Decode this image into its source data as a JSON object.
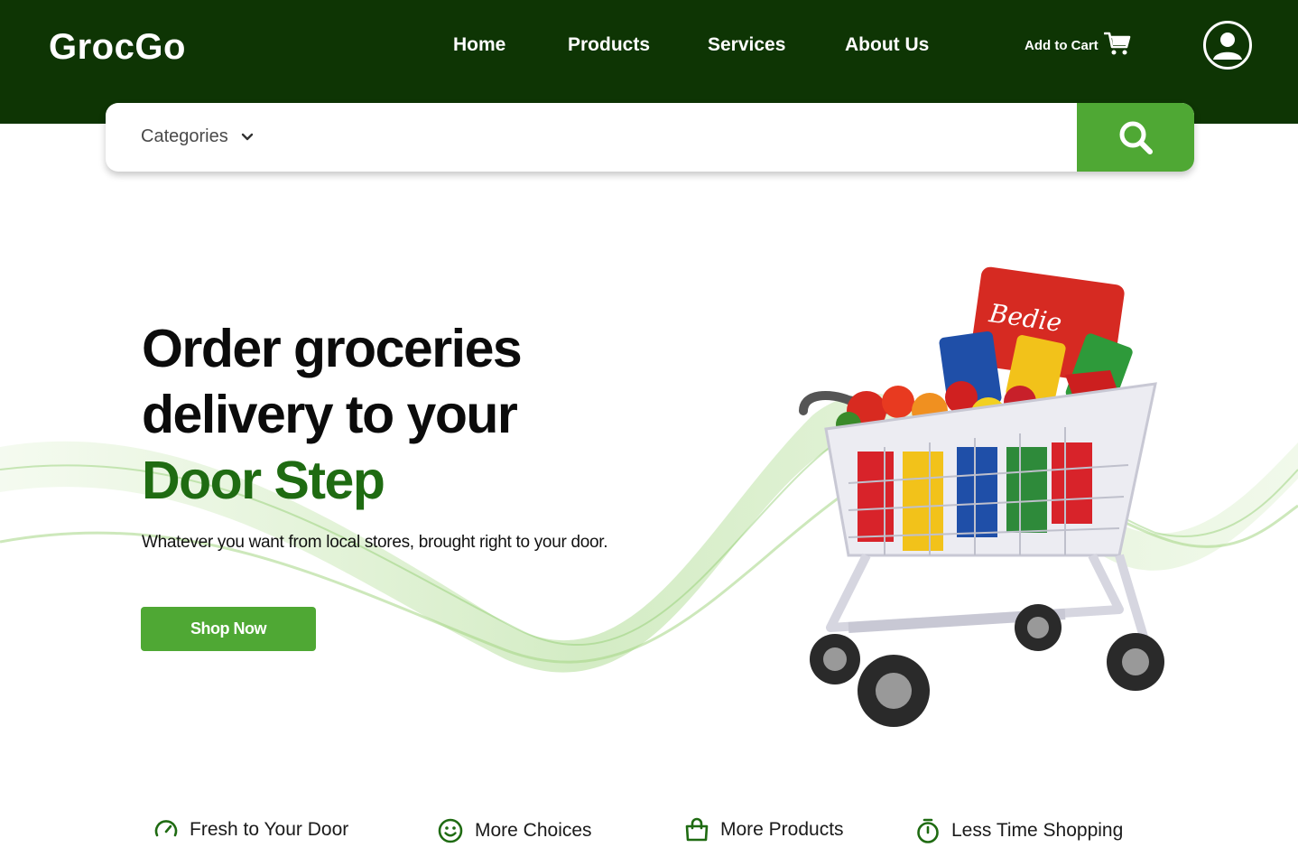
{
  "header": {
    "logo": "GrocGo",
    "nav": [
      {
        "label": "Home"
      },
      {
        "label": "Products"
      },
      {
        "label": "Services"
      },
      {
        "label": "About Us"
      }
    ],
    "cart_label": "Add to Cart",
    "cart_icon": "shopping-cart-icon",
    "profile_icon": "user-circle-icon"
  },
  "search": {
    "categories_label": "Categories",
    "placeholder": "",
    "button_icon": "search-icon"
  },
  "hero": {
    "title_line1": "Order groceries",
    "title_line2": "delivery to your",
    "title_accent": "Door Step",
    "subtitle": "Whatever you want from local stores, brought right to your door.",
    "cta_label": "Shop Now",
    "image": "shopping-cart-full-of-groceries"
  },
  "features": [
    {
      "label": "Fresh to Your Door",
      "icon": "speedometer-icon"
    },
    {
      "label": "More Choices",
      "icon": "smiley-icon"
    },
    {
      "label": "More Products",
      "icon": "shopping-bag-icon"
    },
    {
      "label": "Less Time Shopping",
      "icon": "stopwatch-icon"
    }
  ],
  "colors": {
    "header_bg": "#0e3504",
    "primary_green": "#4fa834",
    "accent_text": "#1f6b12"
  }
}
